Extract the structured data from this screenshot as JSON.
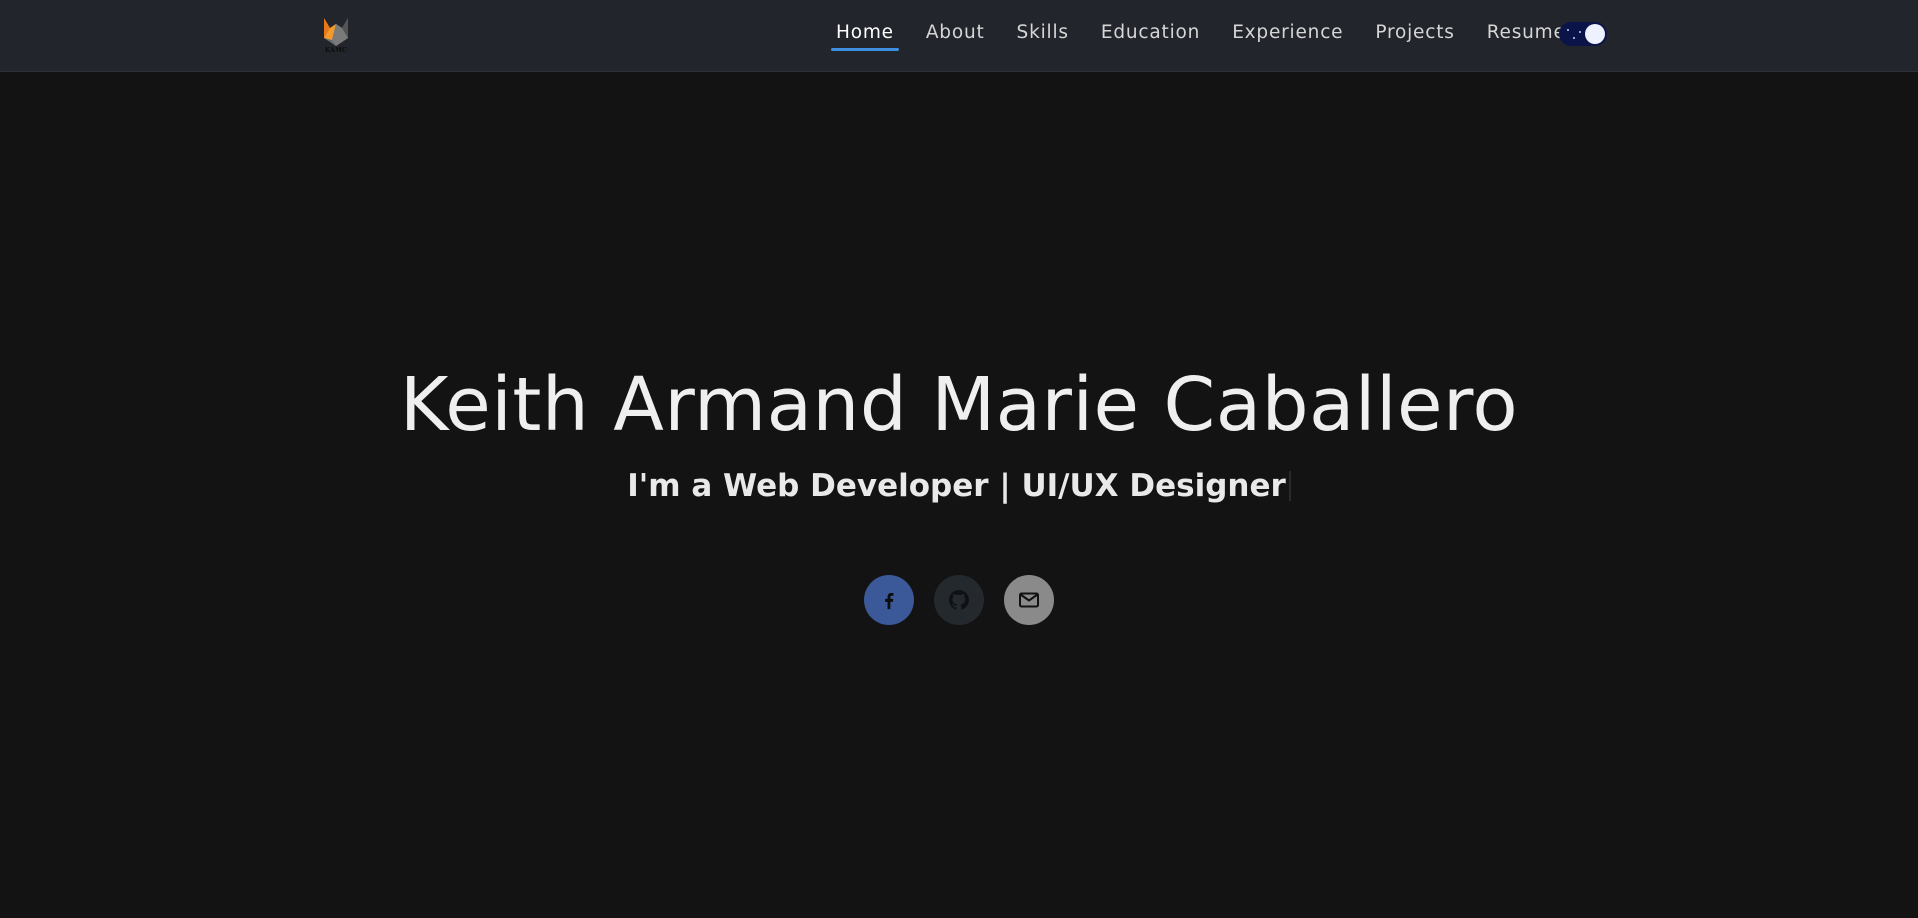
{
  "brand": {
    "logo_icon": "fox-logo-icon",
    "logo_text": "KAMC"
  },
  "nav": {
    "items": [
      {
        "label": "Home",
        "active": true
      },
      {
        "label": "About",
        "active": false
      },
      {
        "label": "Skills",
        "active": false
      },
      {
        "label": "Education",
        "active": false
      },
      {
        "label": "Experience",
        "active": false
      },
      {
        "label": "Projects",
        "active": false
      },
      {
        "label": "Resume",
        "active": false
      }
    ],
    "theme_toggle_icon": "dark-mode-toggle"
  },
  "hero": {
    "name": "Keith Armand Marie Caballero",
    "subtitle_prefix": "I'm a ",
    "subtitle_roles": "Web Developer | UI/UX Designer"
  },
  "socials": [
    {
      "icon": "facebook-icon",
      "color": "#3b5998"
    },
    {
      "icon": "github-icon",
      "color": "#24292e"
    },
    {
      "icon": "mail-icon",
      "color": "#8a8a8a"
    }
  ],
  "colors": {
    "background": "#131313",
    "navbar": "#22252b",
    "accent": "#3f8fe0",
    "text": "#efefef"
  }
}
